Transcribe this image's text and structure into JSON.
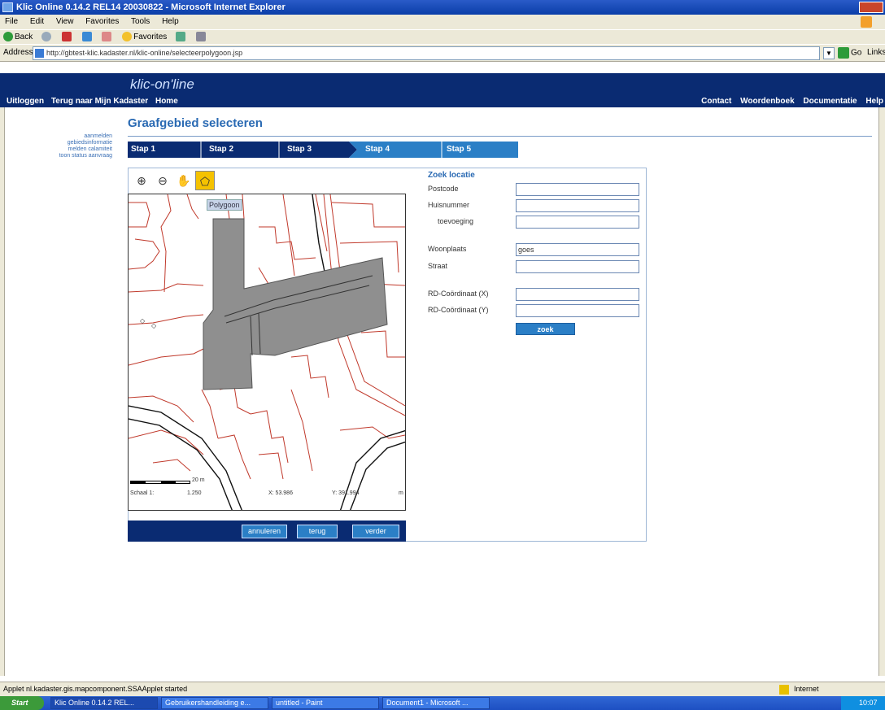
{
  "window": {
    "title": "Klic Online 0.14.2 REL14 20030822 - Microsoft Internet Explorer"
  },
  "menu": [
    "File",
    "Edit",
    "View",
    "Favorites",
    "Tools",
    "Help"
  ],
  "toolbar": {
    "back": "Back",
    "favorites": "Favorites"
  },
  "address": {
    "label": "Address",
    "url": "http://gbtest-klic.kadaster.nl/klic-online/selecteerpolygoon.jsp",
    "go": "Go",
    "links": "Links"
  },
  "site": {
    "logo": "klic-on'line",
    "nav_left": [
      "Uitloggen",
      "Terug naar Mijn Kadaster",
      "Home"
    ],
    "nav_right": [
      "Contact",
      "Woordenboek",
      "Documentatie",
      "Help"
    ]
  },
  "sidebar": {
    "links": [
      "aanmelden",
      "gebiedsinformatie",
      "melden calamiteit",
      "toon status aanvraag"
    ]
  },
  "page": {
    "title": "Graafgebied selecteren"
  },
  "steps": [
    {
      "label": "Stap 1",
      "active": false
    },
    {
      "label": "Stap 2",
      "active": false
    },
    {
      "label": "Stap 3",
      "active": false
    },
    {
      "label": "Stap 4",
      "active": true
    },
    {
      "label": "Stap 5",
      "active": true
    }
  ],
  "map": {
    "tooltip": "Polygoon",
    "scale_label": "20 m",
    "status_scale": "Schaal 1:",
    "status_scale_val": "1.250",
    "status_x": "X: 53.986",
    "status_y": "Y: 391.994",
    "status_unit": "m"
  },
  "buttons": {
    "annuleren": "annuleren",
    "terug": "terug",
    "verder": "verder"
  },
  "form": {
    "heading": "Zoek locatie",
    "fields": [
      {
        "label": "Postcode",
        "value": ""
      },
      {
        "label": "Huisnummer",
        "value": ""
      },
      {
        "label": "toevoeging",
        "value": ""
      },
      {
        "label": "Woonplaats",
        "value": "goes"
      },
      {
        "label": "Straat",
        "value": ""
      },
      {
        "label": "RD-Coördinaat (X)",
        "value": ""
      },
      {
        "label": "RD-Coördinaat (Y)",
        "value": ""
      }
    ],
    "search_button": "zoek"
  },
  "statusbar": {
    "text": "Applet nl.kadaster.gis.mapcomponent.SSAApplet started",
    "zone": "Internet"
  },
  "taskbar": {
    "start": "Start",
    "tasks": [
      "Klic Online 0.14.2 REL...",
      "Gebruikershandleiding e...",
      "untitled - Paint",
      "Document1 - Microsoft ..."
    ],
    "clock": "10:07"
  },
  "colors": {
    "navy": "#0a2b72",
    "accent": "#2b7fc6",
    "title": "#2a6ab3",
    "polygon": "#8f8f8f",
    "parcel_lines": "#c0392b"
  }
}
